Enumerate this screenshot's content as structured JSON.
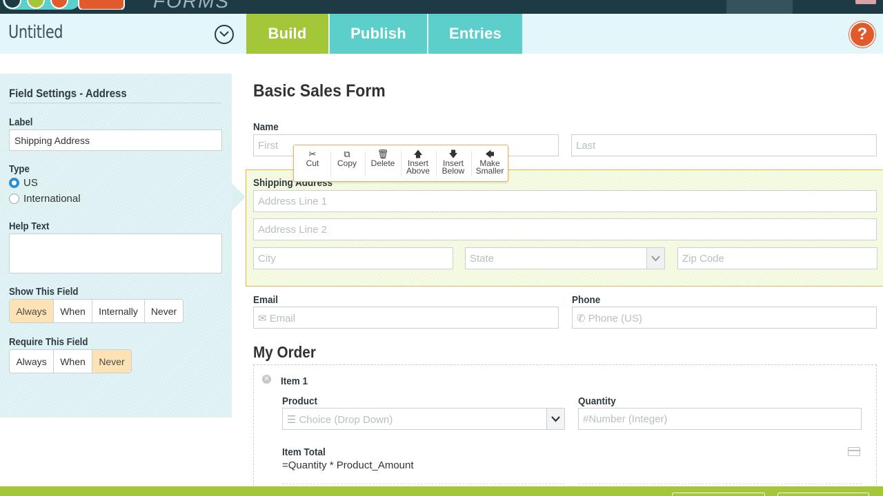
{
  "app": {
    "brand_text": "FORMS",
    "form_name": "Untitled",
    "colors": {
      "build_tab": "#a4c73a",
      "tab": "#5ccfcb",
      "help": "#e05a2b",
      "dark_bar": "#1e3a45",
      "selected_field": "#e1b45a"
    }
  },
  "nav": {
    "tabs": [
      {
        "label": "Build",
        "active": true
      },
      {
        "label": "Publish",
        "active": false
      },
      {
        "label": "Entries",
        "active": false
      }
    ],
    "help_label": "?"
  },
  "settings": {
    "heading": "Field Settings - Address",
    "label_title": "Label",
    "label_value": "Shipping Address",
    "type_title": "Type",
    "type_options": [
      {
        "label": "US",
        "selected": true
      },
      {
        "label": "International",
        "selected": false
      }
    ],
    "help_text_title": "Help Text",
    "help_text_value": "",
    "show_title": "Show This Field",
    "show_options": [
      {
        "label": "Always",
        "active": true
      },
      {
        "label": "When",
        "active": false
      },
      {
        "label": "Internally",
        "active": false
      },
      {
        "label": "Never",
        "active": false
      }
    ],
    "require_title": "Require This Field",
    "require_options": [
      {
        "label": "Always",
        "active": false
      },
      {
        "label": "When",
        "active": false
      },
      {
        "label": "Never",
        "active": true
      }
    ]
  },
  "form": {
    "title": "Basic Sales Form",
    "name": {
      "label": "Name",
      "first_placeholder": "First",
      "last_placeholder": "Last"
    },
    "toolbar": [
      {
        "icon": "cut-icon",
        "line1": "Cut",
        "line2": ""
      },
      {
        "icon": "copy-icon",
        "line1": "Copy",
        "line2": ""
      },
      {
        "icon": "delete-icon",
        "line1": "Delete",
        "line2": ""
      },
      {
        "icon": "arrow-up-icon",
        "line1": "Insert",
        "line2": "Above"
      },
      {
        "icon": "arrow-down-icon",
        "line1": "Insert",
        "line2": "Below"
      },
      {
        "icon": "arrow-left-icon",
        "line1": "Make",
        "line2": "Smaller"
      }
    ],
    "address": {
      "label": "Shipping Address",
      "line1_placeholder": "Address Line 1",
      "line2_placeholder": "Address Line 2",
      "city_placeholder": "City",
      "state_placeholder": "State",
      "zip_placeholder": "Zip Code"
    },
    "email": {
      "label": "Email",
      "placeholder": "Email",
      "icon": "envelope-icon"
    },
    "phone": {
      "label": "Phone",
      "placeholder": "Phone (US)",
      "icon": "phone-icon"
    },
    "order": {
      "heading": "My Order",
      "item_title": "Item 1",
      "product_label": "Product",
      "product_placeholder": "Choice (Drop Down)",
      "product_icon": "list-icon",
      "quantity_label": "Quantity",
      "quantity_placeholder": "Number (Integer)",
      "quantity_icon": "#",
      "total_label": "Item Total",
      "total_formula": "=Quantity * Product_Amount"
    }
  }
}
